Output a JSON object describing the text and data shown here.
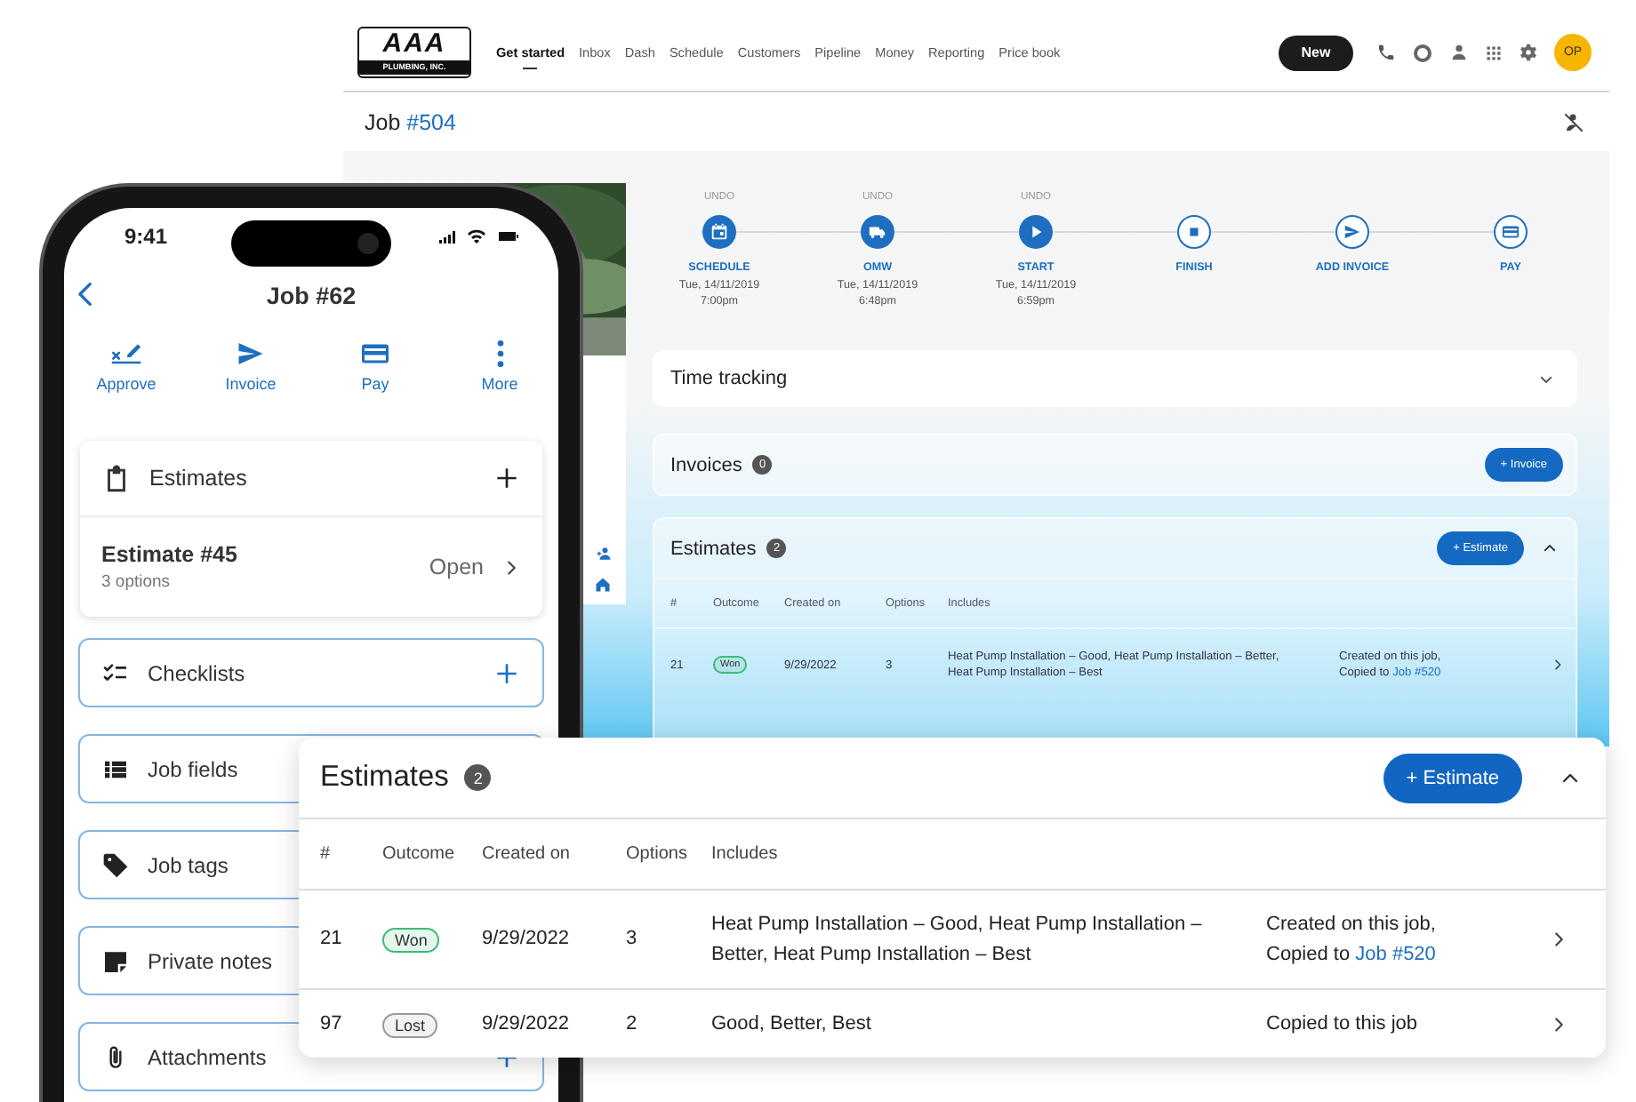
{
  "desktop": {
    "logo": {
      "mark": "AAA",
      "caption": "PLUMBING, INC."
    },
    "nav": [
      {
        "label": "Get started",
        "selected": true
      },
      {
        "label": "Inbox",
        "selected": false
      },
      {
        "label": "Dash",
        "selected": false
      },
      {
        "label": "Schedule",
        "selected": false
      },
      {
        "label": "Customers",
        "selected": false
      },
      {
        "label": "Pipeline",
        "selected": false
      },
      {
        "label": "Money",
        "selected": false
      },
      {
        "label": "Reporting",
        "selected": false
      },
      {
        "label": "Price book",
        "selected": false
      }
    ],
    "new_button": "New",
    "avatar": "OP",
    "job": {
      "label": "Job",
      "number": "#504"
    },
    "steps": [
      {
        "label": "SCHEDULE",
        "undo": "UNDO",
        "date": "Tue, 14/11/2019",
        "time": "7:00pm",
        "done": true
      },
      {
        "label": "OMW",
        "undo": "UNDO",
        "date": "Tue, 14/11/2019",
        "time": "6:48pm",
        "done": true
      },
      {
        "label": "START",
        "undo": "UNDO",
        "date": "Tue, 14/11/2019",
        "time": "6:59pm",
        "done": true
      },
      {
        "label": "FINISH",
        "done": false
      },
      {
        "label": "ADD INVOICE",
        "done": false
      },
      {
        "label": "PAY",
        "done": false
      }
    ],
    "time_tracking": {
      "title": "Time tracking",
      "expanded": false
    },
    "invoices": {
      "title": "Invoices",
      "count": "0",
      "button": "+ Invoice"
    },
    "estimates": {
      "title": "Estimates",
      "count": "2",
      "button": "+ Estimate",
      "expanded": true,
      "columns": [
        "#",
        "Outcome",
        "Created on",
        "Options",
        "Includes"
      ],
      "rows": [
        {
          "number": "21",
          "outcome": {
            "label": "Won",
            "color": "#3dbb77"
          },
          "created_on": "9/29/2022",
          "options": "3",
          "includes": "Heat Pump Installation – Good, Heat Pump Installation – Better, Heat Pump Installation – Best",
          "status": "Created on this job,",
          "link_prefix": "Copied to",
          "link": "Job #520"
        }
      ]
    }
  },
  "phone": {
    "time": "9:41",
    "title": "Job #62",
    "actions": [
      "Approve",
      "Invoice",
      "Pay",
      "More"
    ],
    "estimates": {
      "title": "Estimates",
      "item": {
        "title": "Estimate #45",
        "subtitle": "3 options",
        "status": "Open"
      }
    },
    "sections": [
      "Checklists",
      "Job fields",
      "Job tags",
      "Private notes",
      "Attachments"
    ]
  },
  "estimates_card": {
    "title": "Estimates",
    "count": "2",
    "button": "+ Estimate",
    "expanded": true,
    "columns": [
      "#",
      "Outcome",
      "Created on",
      "Options",
      "Includes"
    ],
    "rows": [
      {
        "number": "21",
        "outcome": {
          "label": "Won",
          "color": "#3dbb77"
        },
        "created_on": "9/29/2022",
        "options": "3",
        "includes": "Heat Pump Installation – Good, Heat Pump Installation – Better, Heat Pump Installation – Best",
        "status": "Created on this job,",
        "link_prefix": "Copied to",
        "link": "Job #520"
      },
      {
        "number": "97",
        "outcome": {
          "label": "Lost",
          "color": "#9a9a9a"
        },
        "created_on": "9/29/2022",
        "options": "2",
        "includes": "Good, Better, Best",
        "status": "Copied to this job"
      }
    ]
  }
}
